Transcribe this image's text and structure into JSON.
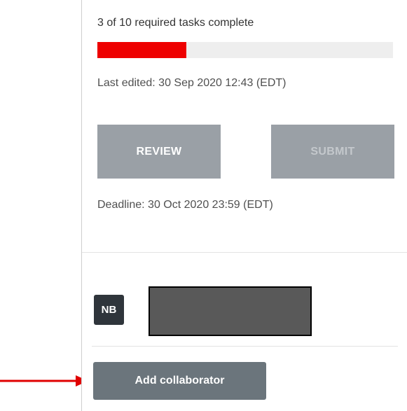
{
  "progress": {
    "text": "3 of 10 required tasks complete",
    "completed": 3,
    "total": 10,
    "fill_color": "#ee0000",
    "track_color": "#eeeeee"
  },
  "last_edited": "Last edited: 30 Sep 2020 12:43 (EDT)",
  "actions": {
    "review_label": "REVIEW",
    "submit_label": "SUBMIT"
  },
  "deadline": "Deadline: 30 Oct 2020 23:59 (EDT)",
  "collaborator": {
    "initials": "NB",
    "name_redacted": true
  },
  "add_collaborator_label": "Add collaborator",
  "annotation": {
    "arrow_color": "#e00000",
    "arrow_icon": "arrow-right-icon"
  },
  "colors": {
    "button_disabled": "#9aa0a6",
    "button_secondary": "#6b757c",
    "avatar_bg": "#2f353b"
  }
}
